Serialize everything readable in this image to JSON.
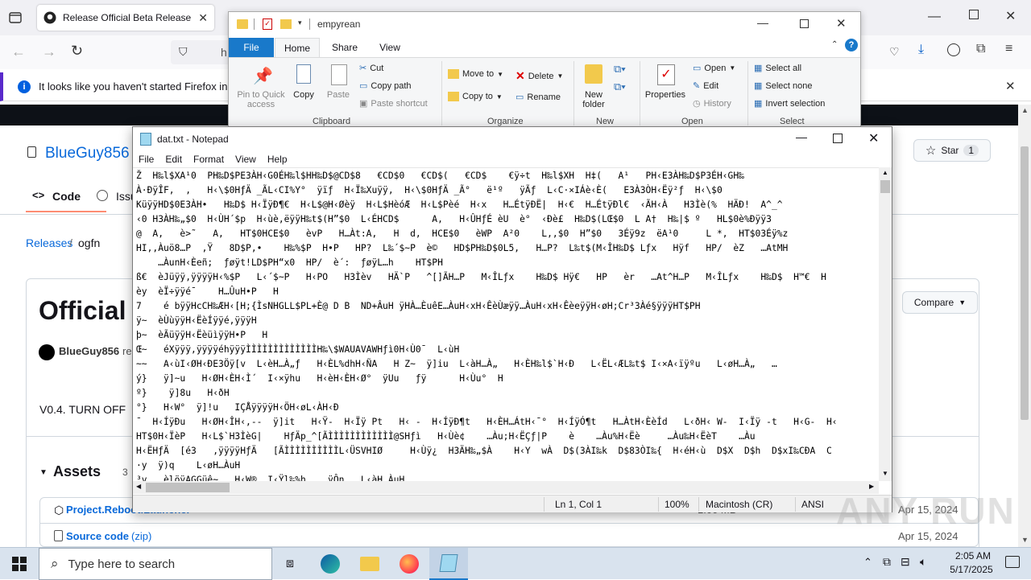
{
  "firefox": {
    "tab_title": "Release Official Beta Release! · B",
    "url_partial": "h",
    "notice": "It looks like you haven't started Firefox in a wh"
  },
  "github": {
    "repo_owner": "BlueGuy856",
    "tab_code": "Code",
    "tab_issues": "Issu",
    "star_label": "Star",
    "star_count": "1",
    "breadcrumb_releases": "Releases",
    "breadcrumb_sep": "/",
    "breadcrumb_tag": "ogfn",
    "release_title": "Official",
    "author": "BlueGuy856",
    "author_suffix": "re",
    "compare_label": "Compare",
    "description": "V0.4. TURN OFF",
    "assets_label": "Assets",
    "assets_count": "3",
    "assets": [
      {
        "name": "Project.Reboot.Launcher",
        "date": "Apr 15, 2024",
        "size": "1.00 MB"
      },
      {
        "name": "Source code",
        "suffix": "(zip)",
        "date": "Apr 15, 2024"
      }
    ]
  },
  "explorer": {
    "title": "empyrean",
    "tabs": [
      "File",
      "Home",
      "Share",
      "View"
    ],
    "clipboard": {
      "pin": "Pin to Quick access",
      "copy": "Copy",
      "paste": "Paste",
      "cut": "Cut",
      "copy_path": "Copy path",
      "paste_shortcut": "Paste shortcut",
      "group": "Clipboard"
    },
    "organize": {
      "move_to": "Move to",
      "copy_to": "Copy to",
      "delete": "Delete",
      "rename": "Rename",
      "group": "Organize"
    },
    "new": {
      "new_folder": "New folder",
      "group": "New"
    },
    "open": {
      "properties": "Properties",
      "open": "Open",
      "edit": "Edit",
      "history": "History",
      "group": "Open"
    },
    "select": {
      "select_all": "Select all",
      "select_none": "Select none",
      "invert": "Invert selection",
      "group": "Select"
    }
  },
  "notepad": {
    "title": "dat.txt - Notepad",
    "menu": [
      "File",
      "Edit",
      "Format",
      "View",
      "Help"
    ],
    "content": "Ž  H‰l$XA¹0  PH‰D$PE3ÀH‹G0ÉH‰l$HH‰D$@CD$8   €CD$0   €CD$(   €CD$    €ÿ÷t  H‰l$XH  H‡(   A¹   PH‹E3ÀH‰D$P3ÉH‹GH‰\nÀ·ÐÿÎF‚  ‚   H‹\\$0HƒÄ _ÃL‹CI%Y°  ÿïƒ  H‹Ï‰Xuÿÿ‚  H‹\\$0HƒÄ _Ã°   ë¹º   ÿÃƒ  L‹C·×IÁè‹È(   E3À3ÒH‹Ëÿ²ƒ  H‹\\$0\nKüÿÿHD$0E3ÀH•   H‰D$ H‹ÏÿÐ¶€  H‹L$@H‹Øèÿ  H‹L$HèóÆ  H‹L$Pèé  H‹x   H…ÉtÿÐË|  H‹€  H…ÉtÿÐl€  ‹ÃH‹À   H3Ìè(%  HÄÐ!  A^_^\n‹0 H3ÀH‰„$0  H‹ÙH´$p  H‹ùè‚ëÿÿH‰t$(H”$0  L‹ÉHCD$      A‚   H‹ÛHƒÉ èU  è°  ‹Ðè£  H‰D$(LŒ$0  L A†  H‰|$ º   HL$0è%Ðÿÿ3\n@  A‚   è>˜   A‚   HT$0HCE$0   èvP   H…Àt:A‚   H  d‚  HCE$0   èWP  A²0    L‚‚$0  H”$0   3Éÿ9z  ëA¹0     L *‚  HT$03Éÿ%z\nHI‚‚Àuö8…P  ‚Ÿ   8D$P‚•    H‰%$P  H•P   HP?  L‰´$~P  è©   HD$PH‰D$0L5‚   H…P?  L‰t$(M‹ÎH‰D$ Lƒx   Hÿf   HP/  èZ   …AtMH\n    …ÀunH‹Èeñ;  ƒøÿt!LD$PH“x0  HP/  è´:  ƒøÿL…h    HT$PH\nß€  èJüÿÿ‚ÿÿÿÿH‹%$P   L‹´$~P   H‹PO   H3Ìèv   HÄ`P   ^[]ÃH…P   M‹ÎLƒx    H‰D$ Hÿ€   HP   èr   …At^H…P   M‹ÎLƒx    H‰D$  H™€  H\nèy  èÏ÷ÿÿé¯    H…ÛuH•P   H\n7    é bÿÿHcCH‰ÆH‹[H;{ÌsNHGLL$PL+È@ D B  ND+ÂuH ÿHÀ…ÈuêE…ÀuH‹xH‹ÊèÙæÿÿ…ÀuH‹xH‹ÊèeÿÿH‹øH;Cr³3Àé§ÿÿÿHT$PH\nÿ~  èÙùÿÿH‹ËèÍÿÿé‚ÿÿÿH\nþ~  èÃüÿÿH‹ËèüìÿÿH•P   H\nŒ~   éXÿÿÿ‚ÿÿÿÿéhÿÿÿÌÌÌÌÌÌÌÌÌÌÌÌÌH‰\\$WAUAVAWHƒì0H‹Ù0¯  L‹ùH\n~~   A‹ùI‹ØH‹ÐE3Öÿ[v  L‹èH…À„ƒ   H‹ÈL%dhH‹ÑA   H Z~  ÿ]iu  L‹àH…À„   H‹ÈH‰l$`H‹Ð   L‹ËL‹ÆL‰t$ I‹×A‹ïÿºu   L‹øH…À„   …\ný}   ÿ]~u   H‹ØH‹ÈH‹Ì´  I‹×ÿhu   H‹èH‹ÈH‹Ø°  ÿUu   ƒÿ      H‹Ùu°  H\nº}    ÿ]8u   H‹ðH\n°}   H‹W°  ÿ]!u   IÇÅÿÿÿÿH‹ÖH‹øL‹ÀH‹Ð\n¯  H‹ÍÿÐu   H‹ØH‹ÎH‹‚--  ÿ]it   H‹Ÿ-  H‹Ïÿ Pt   H‹ -  H‹ÍÿÐ¶t   H‹ÈH…ÁtH‹¯°  H‹ÍÿÓ¶t   H…ÀtH‹ÈèÍd   L‹ðH‹ W-  I‹Ïÿ -t   H‹G-  H‹\nHT$0H‹ÏèP   H‹L$`H3ÌèG|    HƒÄp_^[ÃÌÌÌÌÌÌÌÌÌÌÌÌ@SHƒì   H‹Ùè¢    …Àu;H‹ËÇƒ|P    è    …Àu%H‹Ëè     …Àu‰H‹ËèT    …Àu\nH‹ËHƒÄ  [é3   ‚ÿÿÿÿHƒÄ   [ÃÌÌÌÌÌÌÌÌÌÌL‹ÜSVHIØ     H‹Ùÿ¿  H3ÄH‰„$À    H‹Y  wÀ  D$(3ÀI‰k  D$83ÒI‰{  H‹éH‹ù  D$X  D$h  D$xI‰CÐA  C\n·y  ÿ)q    L‹øH…ÀuH\n³v   èlöÿAGGüê~   H‹W®  I‹Ÿl‰%h    ÿÔn   L‹àH…ÀuH",
    "status": {
      "pos": "Ln 1, Col 1",
      "zoom": "100%",
      "eol": "Macintosh (CR)",
      "enc": "ANSI"
    }
  },
  "taskbar": {
    "search_placeholder": "Type here to search",
    "time": "2:05 AM",
    "date": "5/17/2025"
  },
  "watermark": "ANY RUN"
}
